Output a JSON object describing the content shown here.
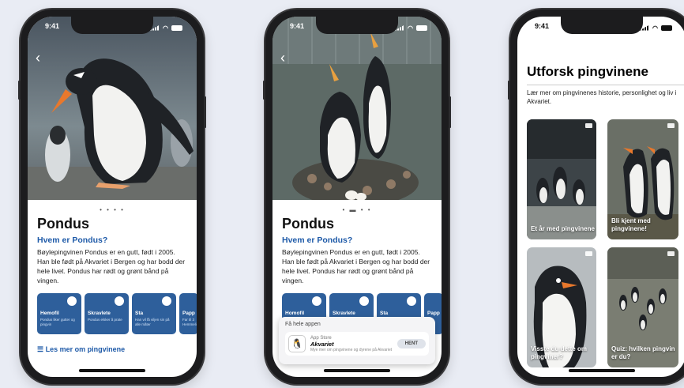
{
  "status_time": "9:41",
  "phone1": {
    "title": "Pondus",
    "question": "Hvem er Pondus?",
    "description": "Bøylepingvinen Pondus er en gutt, født i 2005. Han ble født på Akvariet i Bergen og har bodd der hele livet. Pondus har rødt og grønt bånd på vingen.",
    "pager": "• • • •",
    "cards": [
      {
        "title": "Hemofil",
        "sub": "Pondus liker gutter og pingvin"
      },
      {
        "title": "Skravlete",
        "sub": "Pondus elsker å prate"
      },
      {
        "title": "Sta",
        "sub": "Han vil få viljen sin på alle måter"
      },
      {
        "title": "Papp",
        "sub": "Far til 3 Hemmelig"
      }
    ],
    "read_more": "Les mer om pingvinene"
  },
  "phone2": {
    "title": "Pondus",
    "question": "Hvem er Pondus?",
    "description": "Bøylepingvinen Pondus er en gutt, født i 2005. Han ble født på Akvariet i Bergen og har bodd der hele livet. Pondus har rødt og grønt bånd på vingen.",
    "pager": "• ▬ • •",
    "cards": [
      {
        "title": "Homofil",
        "sub": ""
      },
      {
        "title": "Skravlete",
        "sub": ""
      },
      {
        "title": "Sta",
        "sub": ""
      },
      {
        "title": "Papp",
        "sub": ""
      }
    ],
    "sheet": {
      "title": "Få hele appen",
      "store": "App Store",
      "app_name": "Akvariet",
      "tagline": "Mye mer om pingvinene og dyrene på Akvariet",
      "get": "HENT"
    }
  },
  "phone3": {
    "title": "Utforsk pingvinene",
    "subtitle": "Lær mer om pingvinenes historie, personlighet og liv i Akvariet.",
    "tiles": [
      {
        "label": "Et år med pingvinene"
      },
      {
        "label": "Bli kjent med pingvinene!"
      },
      {
        "label": "Visste du dette om pingviner?"
      },
      {
        "label": "Quiz: hvilken pingvin er du?"
      }
    ]
  },
  "colors": {
    "accent": "#1e5aa8",
    "card": "#2e5f9b",
    "background": "#e9ecf4"
  },
  "icons": [
    "chevron-left-icon",
    "heart-icon",
    "speaker-icon",
    "chat-bubble-icon",
    "video-icon",
    "app-store-icon"
  ]
}
